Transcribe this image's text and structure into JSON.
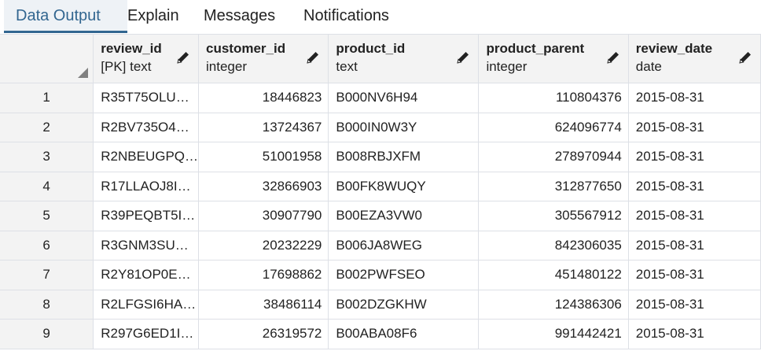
{
  "tabs": [
    {
      "label": "Data Output",
      "active": true
    },
    {
      "label": "Explain",
      "active": false
    },
    {
      "label": "Messages",
      "active": false
    },
    {
      "label": "Notifications",
      "active": false
    }
  ],
  "columns": [
    {
      "name": "review_id",
      "type": "[PK] text"
    },
    {
      "name": "customer_id",
      "type": "integer"
    },
    {
      "name": "product_id",
      "type": "text"
    },
    {
      "name": "product_parent",
      "type": "integer"
    },
    {
      "name": "review_date",
      "type": "date"
    }
  ],
  "rows": [
    {
      "n": "1",
      "review_id": "R35T75OLU…",
      "customer_id": "18446823",
      "product_id": "B000NV6H94",
      "product_parent": "110804376",
      "review_date": "2015-08-31"
    },
    {
      "n": "2",
      "review_id": "R2BV735O4…",
      "customer_id": "13724367",
      "product_id": "B000IN0W3Y",
      "product_parent": "624096774",
      "review_date": "2015-08-31"
    },
    {
      "n": "3",
      "review_id": "R2NBEUGPQ…",
      "customer_id": "51001958",
      "product_id": "B008RBJXFM",
      "product_parent": "278970944",
      "review_date": "2015-08-31"
    },
    {
      "n": "4",
      "review_id": "R17LLAOJ8I…",
      "customer_id": "32866903",
      "product_id": "B00FK8WUQY",
      "product_parent": "312877650",
      "review_date": "2015-08-31"
    },
    {
      "n": "5",
      "review_id": "R39PEQBT5I…",
      "customer_id": "30907790",
      "product_id": "B00EZA3VW0",
      "product_parent": "305567912",
      "review_date": "2015-08-31"
    },
    {
      "n": "6",
      "review_id": "R3GNM3SU…",
      "customer_id": "20232229",
      "product_id": "B006JA8WEG",
      "product_parent": "842306035",
      "review_date": "2015-08-31"
    },
    {
      "n": "7",
      "review_id": "R2Y81OP0E…",
      "customer_id": "17698862",
      "product_id": "B002PWFSEO",
      "product_parent": "451480122",
      "review_date": "2015-08-31"
    },
    {
      "n": "8",
      "review_id": "R2LFGSI6HA…",
      "customer_id": "38486114",
      "product_id": "B002DZGKHW",
      "product_parent": "124386306",
      "review_date": "2015-08-31"
    },
    {
      "n": "9",
      "review_id": "R297G6ED1I…",
      "customer_id": "26319572",
      "product_id": "B00ABA08F6",
      "product_parent": "991442421",
      "review_date": "2015-08-31"
    }
  ],
  "icons": {
    "edit": "pencil-icon",
    "select_all": "select-all-corner-icon"
  },
  "colors": {
    "accent": "#326690",
    "header_bg": "#f3f3f3",
    "grid_line": "#dde0e6"
  }
}
